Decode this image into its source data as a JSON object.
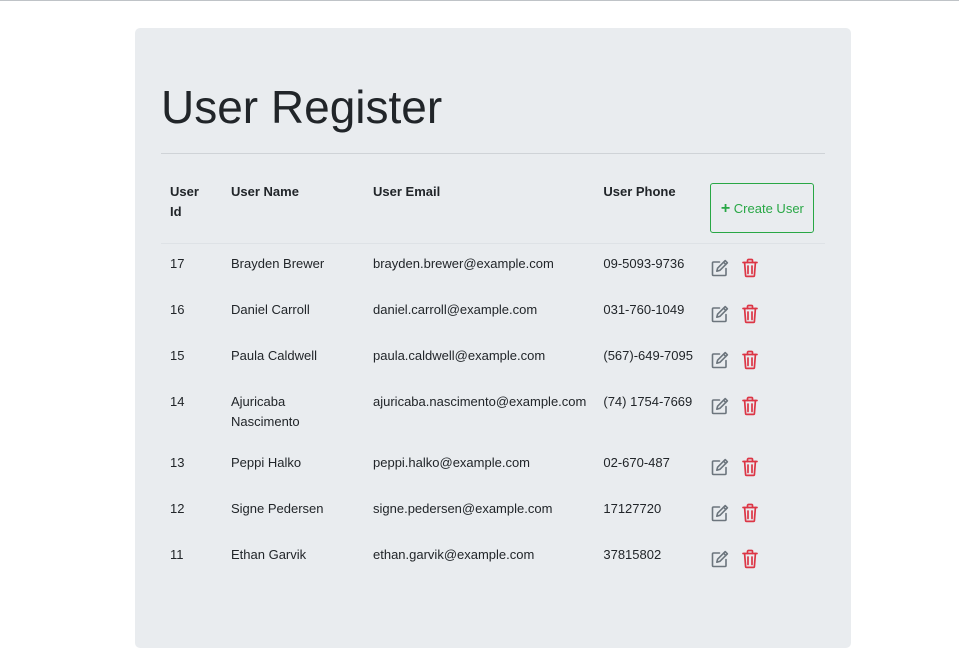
{
  "page": {
    "title": "User Register"
  },
  "table": {
    "headers": {
      "id": "User Id",
      "name": "User Name",
      "email": "User Email",
      "phone": "User Phone"
    },
    "create_button_label": "Create User",
    "rows": [
      {
        "id": "17",
        "name": "Brayden Brewer",
        "email": "brayden.brewer@example.com",
        "phone": "09-5093-9736"
      },
      {
        "id": "16",
        "name": "Daniel Carroll",
        "email": "daniel.carroll@example.com",
        "phone": "031-760-1049"
      },
      {
        "id": "15",
        "name": "Paula Caldwell",
        "email": "paula.caldwell@example.com",
        "phone": "(567)-649-7095"
      },
      {
        "id": "14",
        "name": "Ajuricaba Nascimento",
        "email": "ajuricaba.nascimento@example.com",
        "phone": "(74) 1754-7669"
      },
      {
        "id": "13",
        "name": "Peppi Halko",
        "email": "peppi.halko@example.com",
        "phone": "02-670-487"
      },
      {
        "id": "12",
        "name": "Signe Pedersen",
        "email": "signe.pedersen@example.com",
        "phone": "17127720"
      },
      {
        "id": "11",
        "name": "Ethan Garvik",
        "email": "ethan.garvik@example.com",
        "phone": "37815802"
      }
    ]
  },
  "colors": {
    "create_button": "#28a745",
    "edit_icon": "#6c757d",
    "delete_icon": "#dc3545",
    "panel_background": "#e9ecef"
  },
  "icons": {
    "create": "plus-icon",
    "edit": "edit-icon",
    "delete": "trash-icon"
  }
}
